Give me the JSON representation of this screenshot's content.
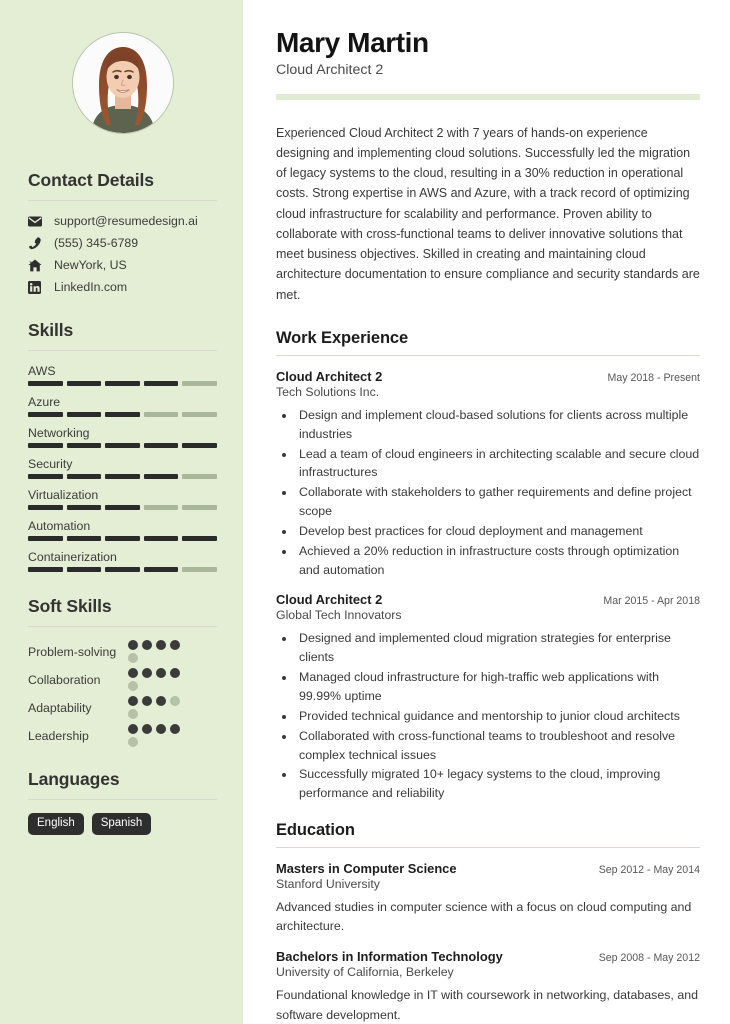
{
  "sidebar": {
    "avatar": {
      "alt": "profile-photo"
    },
    "contact": {
      "heading": "Contact Details",
      "items": [
        {
          "icon": "envelope-icon",
          "text": "support@resumedesign.ai"
        },
        {
          "icon": "phone-icon",
          "text": "(555) 345-6789"
        },
        {
          "icon": "home-icon",
          "text": "NewYork, US"
        },
        {
          "icon": "linkedin-icon",
          "text": "LinkedIn.com"
        }
      ]
    },
    "skills": {
      "heading": "Skills",
      "max": 5,
      "items": [
        {
          "label": "AWS",
          "level": 4
        },
        {
          "label": "Azure",
          "level": 3
        },
        {
          "label": "Networking",
          "level": 5
        },
        {
          "label": "Security",
          "level": 4
        },
        {
          "label": "Virtualization",
          "level": 3
        },
        {
          "label": "Automation",
          "level": 5
        },
        {
          "label": "Containerization",
          "level": 4
        }
      ]
    },
    "soft_skills": {
      "heading": "Soft Skills",
      "max": 5,
      "items": [
        {
          "label": "Problem-solving",
          "level": 4
        },
        {
          "label": "Collaboration",
          "level": 4
        },
        {
          "label": "Adaptability",
          "level": 3
        },
        {
          "label": "Leadership",
          "level": 4
        }
      ]
    },
    "languages": {
      "heading": "Languages",
      "tags": [
        "English",
        "Spanish"
      ]
    }
  },
  "main": {
    "name": "Mary Martin",
    "job_title": "Cloud Architect 2",
    "summary": "Experienced Cloud Architect 2 with 7 years of hands-on experience designing and implementing cloud solutions. Successfully led the migration of legacy systems to the cloud, resulting in a 30% reduction in operational costs. Strong expertise in AWS and Azure, with a track record of optimizing cloud infrastructure for scalability and performance. Proven ability to collaborate with cross-functional teams to deliver innovative solutions that meet business objectives. Skilled in creating and maintaining cloud architecture documentation to ensure compliance and security standards are met.",
    "work": {
      "heading": "Work Experience",
      "entries": [
        {
          "role": "Cloud Architect 2",
          "organization": "Tech Solutions Inc.",
          "date": "May 2018 - Present",
          "bullets": [
            "Design and implement cloud-based solutions for clients across multiple industries",
            "Lead a team of cloud engineers in architecting scalable and secure cloud infrastructures",
            "Collaborate with stakeholders to gather requirements and define project scope",
            "Develop best practices for cloud deployment and management",
            "Achieved a 20% reduction in infrastructure costs through optimization and automation"
          ]
        },
        {
          "role": "Cloud Architect 2",
          "organization": "Global Tech Innovators",
          "date": "Mar 2015 - Apr 2018",
          "bullets": [
            "Designed and implemented cloud migration strategies for enterprise clients",
            "Managed cloud infrastructure for high-traffic web applications with 99.99% uptime",
            "Provided technical guidance and mentorship to junior cloud architects",
            "Collaborated with cross-functional teams to troubleshoot and resolve complex technical issues",
            "Successfully migrated 10+ legacy systems to the cloud, improving performance and reliability"
          ]
        }
      ]
    },
    "education": {
      "heading": "Education",
      "entries": [
        {
          "degree": "Masters in Computer Science",
          "school": "Stanford University",
          "date": "Sep 2012 - May 2014",
          "description": "Advanced studies in computer science with a focus on cloud computing and architecture."
        },
        {
          "degree": "Bachelors in Information Technology",
          "school": "University of California, Berkeley",
          "date": "Sep 2008 - May 2012",
          "description": "Foundational knowledge in IT with coursework in networking, databases, and software development."
        }
      ]
    }
  },
  "colors": {
    "sidebar_bg": "#e3eed4",
    "accent_bar": "#e1edd2",
    "skill_filled": "#2b2b2b",
    "skill_empty": "#aab79b",
    "dot_filled": "#3b3b3b",
    "dot_empty": "#b6c2a7",
    "tag_bg": "#2e2e2e"
  }
}
